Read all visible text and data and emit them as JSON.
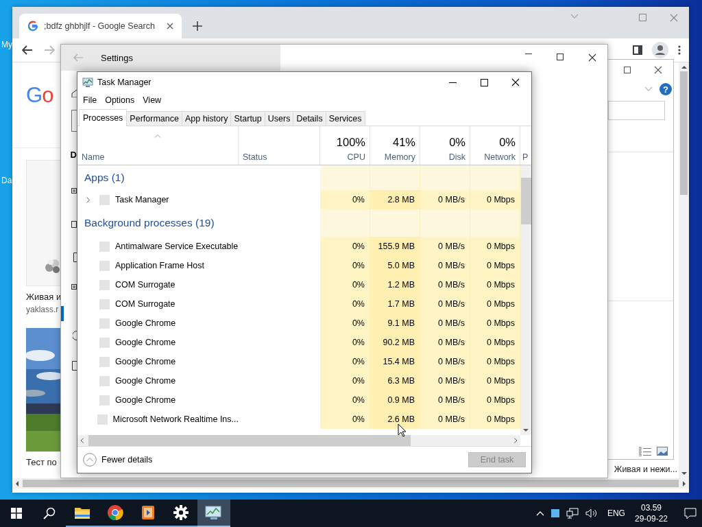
{
  "desktop": {
    "icon_labels": [
      "My",
      "Da"
    ]
  },
  "browser": {
    "tab_title": ";bdfz ghbhjlf - Google Search",
    "logo_text": "Go",
    "results": [
      {
        "title": "Живая и",
        "source": "yaklass.r",
        "kind": "card"
      },
      {
        "title": "Тест по"
      }
    ],
    "right_result_title": "Живая и нежи..."
  },
  "dialog": {
    "help": "?"
  },
  "settings": {
    "title": "Settings",
    "nav_fragment": "D"
  },
  "task_manager": {
    "title": "Task Manager",
    "menu": [
      "File",
      "Options",
      "View"
    ],
    "tabs": [
      {
        "label": "Processes",
        "selected": true
      },
      {
        "label": "Performance",
        "selected": false
      },
      {
        "label": "App history",
        "selected": false
      },
      {
        "label": "Startup",
        "selected": false
      },
      {
        "label": "Users",
        "selected": false
      },
      {
        "label": "Details",
        "selected": false
      },
      {
        "label": "Services",
        "selected": false
      }
    ],
    "columns": [
      {
        "label": "Name",
        "sorted": true
      },
      {
        "label": "Status",
        "sorted": false
      },
      {
        "usage": "100%",
        "label": "CPU",
        "sorted": false
      },
      {
        "usage": "41%",
        "label": "Memory",
        "sorted": false
      },
      {
        "usage": "0%",
        "label": "Disk",
        "sorted": false
      },
      {
        "usage": "0%",
        "label": "Network",
        "sorted": false
      },
      {
        "label": "P",
        "sorted": false
      }
    ],
    "groups": [
      {
        "title": "Apps (1)",
        "rows": [
          {
            "name": "Task Manager",
            "expandable": true,
            "cpu": "0%",
            "memory": "2.8 MB",
            "disk": "0 MB/s",
            "network": "0 Mbps"
          }
        ]
      },
      {
        "title": "Background processes (19)",
        "rows": [
          {
            "name": "Antimalware Service Executable",
            "expandable": false,
            "cpu": "0%",
            "memory": "155.9 MB",
            "disk": "0 MB/s",
            "network": "0 Mbps"
          },
          {
            "name": "Application Frame Host",
            "expandable": false,
            "cpu": "0%",
            "memory": "5.0 MB",
            "disk": "0 MB/s",
            "network": "0 Mbps"
          },
          {
            "name": "COM Surrogate",
            "expandable": false,
            "cpu": "0%",
            "memory": "1.2 MB",
            "disk": "0 MB/s",
            "network": "0 Mbps"
          },
          {
            "name": "COM Surrogate",
            "expandable": false,
            "cpu": "0%",
            "memory": "1.7 MB",
            "disk": "0 MB/s",
            "network": "0 Mbps"
          },
          {
            "name": "Google Chrome",
            "expandable": false,
            "cpu": "0%",
            "memory": "9.1 MB",
            "disk": "0 MB/s",
            "network": "0 Mbps"
          },
          {
            "name": "Google Chrome",
            "expandable": false,
            "cpu": "0%",
            "memory": "90.2 MB",
            "disk": "0 MB/s",
            "network": "0 Mbps"
          },
          {
            "name": "Google Chrome",
            "expandable": false,
            "cpu": "0%",
            "memory": "15.4 MB",
            "disk": "0 MB/s",
            "network": "0 Mbps"
          },
          {
            "name": "Google Chrome",
            "expandable": false,
            "cpu": "0%",
            "memory": "6.3 MB",
            "disk": "0 MB/s",
            "network": "0 Mbps"
          },
          {
            "name": "Google Chrome",
            "expandable": false,
            "cpu": "0%",
            "memory": "0.9 MB",
            "disk": "0 MB/s",
            "network": "0 Mbps"
          },
          {
            "name": "Microsoft Network Realtime Ins...",
            "expandable": false,
            "cpu": "0%",
            "memory": "2.6 MB",
            "disk": "0 MB/s",
            "network": "0 Mbps"
          }
        ]
      }
    ],
    "footer": {
      "toggle": "Fewer details",
      "end_task": {
        "label": "End task",
        "disabled": true
      }
    }
  },
  "taskbar": {
    "apps": [
      {
        "kind": "start",
        "running": false,
        "selected": false
      },
      {
        "kind": "search",
        "running": false,
        "selected": false
      },
      {
        "kind": "folder",
        "running": true,
        "selected": false
      },
      {
        "kind": "round-logo",
        "running": true,
        "selected": false
      },
      {
        "kind": "media",
        "running": true,
        "selected": false
      },
      {
        "kind": "gear",
        "running": true,
        "selected": false
      },
      {
        "kind": "monitor",
        "running": true,
        "selected": true
      }
    ],
    "language": "ENG",
    "time": "03.59",
    "date": "29-09-22"
  }
}
